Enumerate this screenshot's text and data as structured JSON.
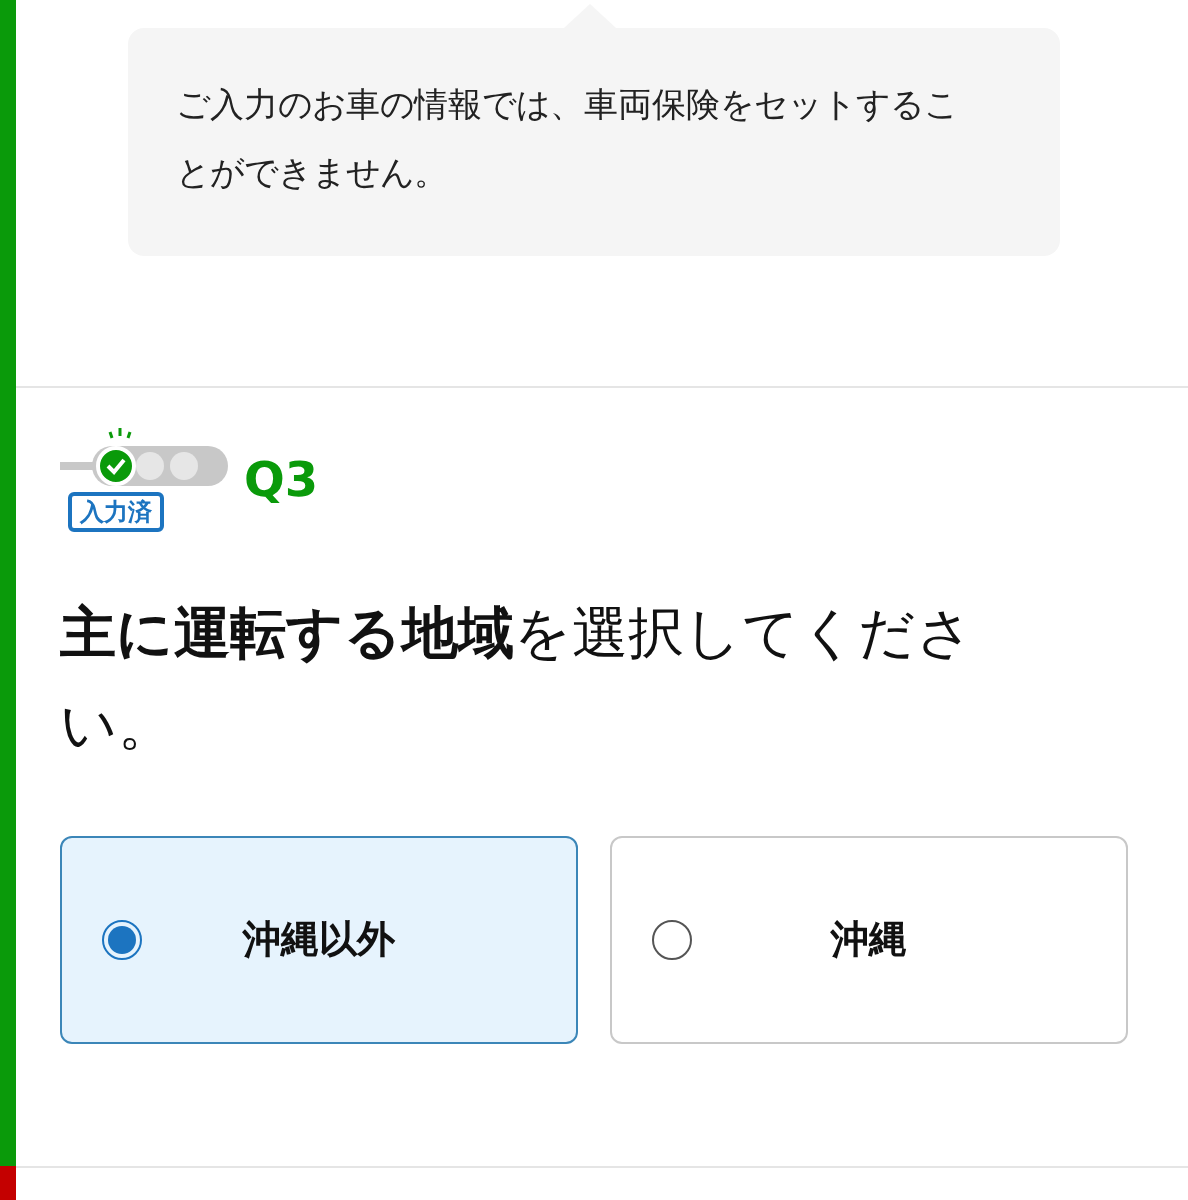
{
  "notice": {
    "text": "ご入力のお車の情報では、車両保険をセットすることができません。"
  },
  "question": {
    "answered": true,
    "status": "入力済",
    "number": "Q3",
    "text": "**主に運転する地域**を選択してください。",
    "options": [
      {
        "label": "沖縄以外",
        "selected": true
      },
      {
        "label": "沖縄",
        "selected": false
      }
    ]
  },
  "next_section": {
    "answered": false
  }
}
